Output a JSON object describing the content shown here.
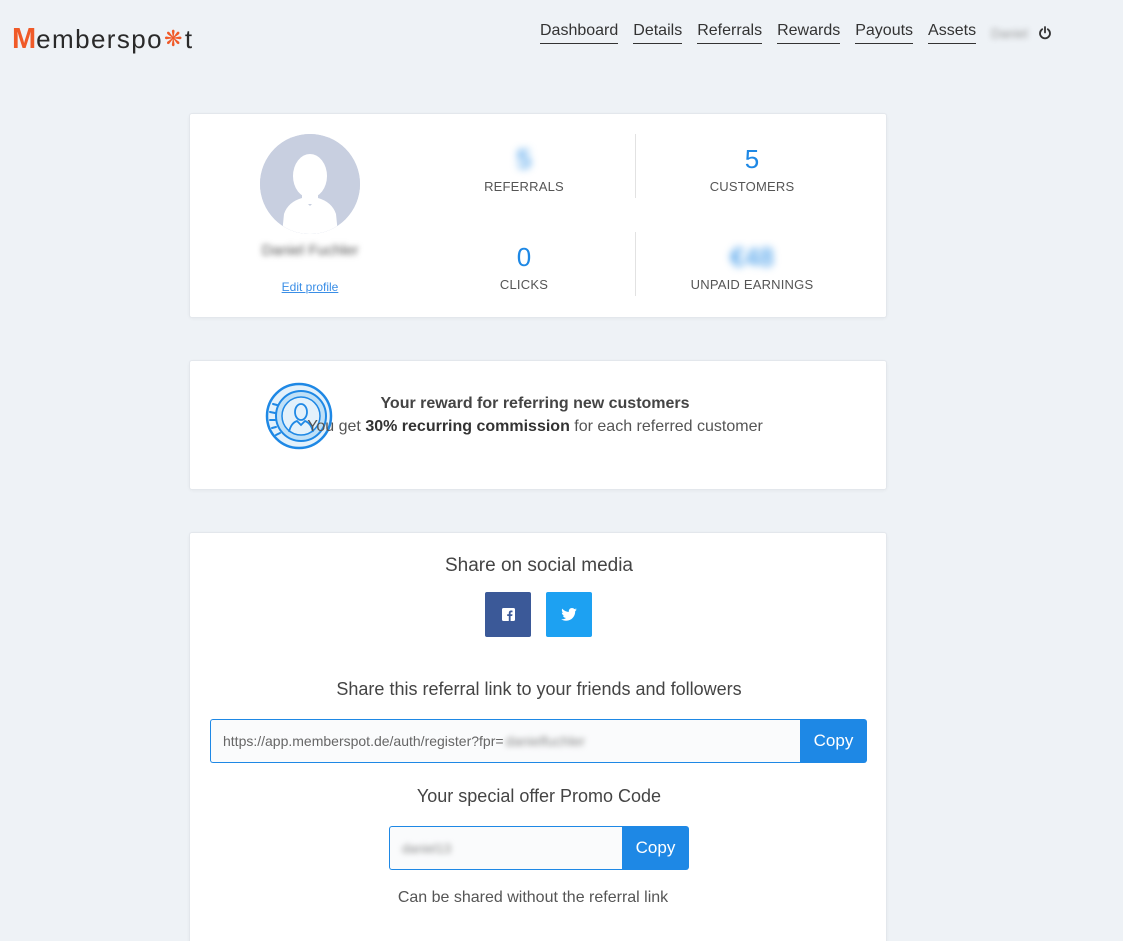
{
  "header": {
    "logo": {
      "first": "M",
      "middle": "emberspo",
      "dot": "❋",
      "last": "t"
    },
    "nav": [
      "Dashboard",
      "Details",
      "Referrals",
      "Rewards",
      "Payouts",
      "Assets"
    ],
    "user_name": "Daniel"
  },
  "profile": {
    "name": "Daniel Fuchler",
    "edit_label": "Edit profile"
  },
  "stats": {
    "referrals": {
      "value": "5",
      "label": "REFERRALS"
    },
    "customers": {
      "value": "5",
      "label": "CUSTOMERS"
    },
    "clicks": {
      "value": "0",
      "label": "CLICKS"
    },
    "unpaid": {
      "value": "€48",
      "label": "UNPAID EARNINGS"
    }
  },
  "reward": {
    "title": "Your reward for referring new customers",
    "text_prefix": "You get ",
    "text_bold": "30% recurring commission",
    "text_suffix": " for each referred customer"
  },
  "share": {
    "social_title": "Share on social media",
    "link_title": "Share this referral link to your friends and followers",
    "link_base": "https://app.memberspot.de/auth/register?fpr=",
    "link_code": "danielfuchler",
    "copy_label": "Copy",
    "promo_title": "Your special offer Promo Code",
    "promo_code": "daniel13",
    "promo_note": "Can be shared without the referral link"
  },
  "colors": {
    "accent": "#1e88e5",
    "brand": "#f05a28",
    "facebook": "#3b5998",
    "twitter": "#1da1f2"
  }
}
